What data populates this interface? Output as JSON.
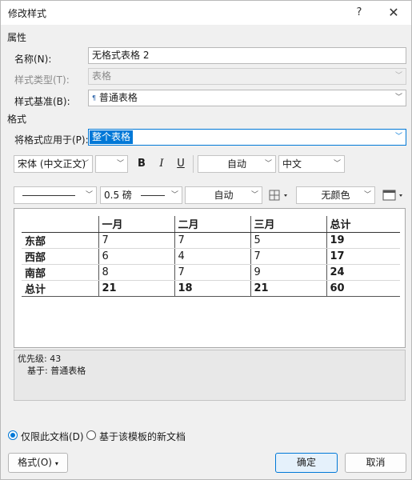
{
  "window": {
    "title": "修改样式",
    "help": "?",
    "close": "✕"
  },
  "properties": {
    "section": "属性",
    "name_label": "名称(N):",
    "name_value": "无格式表格 2",
    "type_label": "样式类型(T):",
    "type_value": "表格",
    "based_on_label": "样式基准(B):",
    "based_on_icon": "¶",
    "based_on_value": "普通表格"
  },
  "format": {
    "section": "格式",
    "apply_label": "将格式应用于(P):",
    "apply_value": "整个表格",
    "font": "宋体 (中文正文)",
    "size": "",
    "bold": "B",
    "italic": "I",
    "underline": "U",
    "color": "自动",
    "script": "中文",
    "border_weight": "0.5 磅",
    "border_color": "自动",
    "shading": "无颜色"
  },
  "preview": {
    "headers": [
      "",
      "一月",
      "二月",
      "三月",
      "总计"
    ],
    "rows": [
      [
        "东部",
        "7",
        "7",
        "5",
        "19"
      ],
      [
        "西部",
        "6",
        "4",
        "7",
        "17"
      ],
      [
        "南部",
        "8",
        "7",
        "9",
        "24"
      ],
      [
        "总计",
        "21",
        "18",
        "21",
        "60"
      ]
    ]
  },
  "description": {
    "priority": "优先级: 43",
    "based_on": "基于: 普通表格"
  },
  "options": {
    "this_doc": "仅限此文档(D)",
    "new_docs": "基于该模板的新文档"
  },
  "buttons": {
    "format": "格式(O)",
    "ok": "确定",
    "cancel": "取消"
  }
}
